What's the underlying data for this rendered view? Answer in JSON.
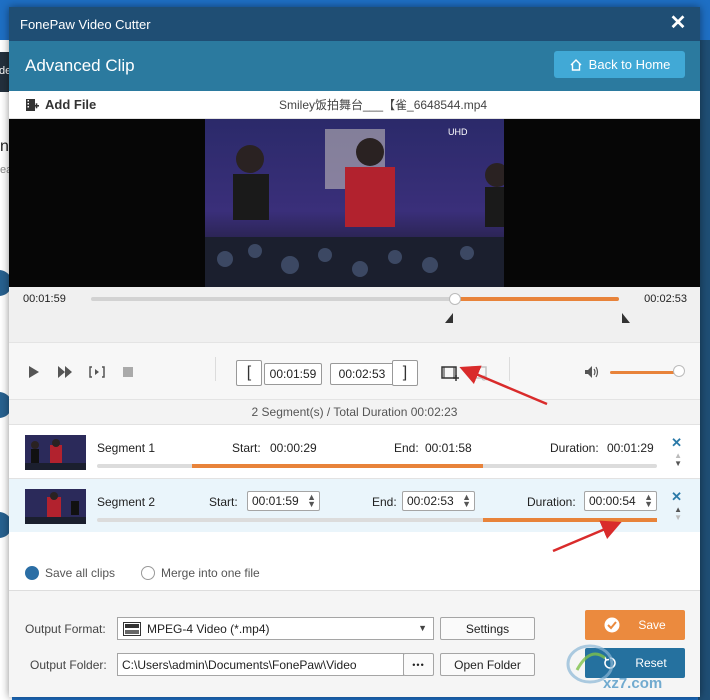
{
  "window": {
    "title": "FonePaw Video Cutter",
    "close_label": "✕"
  },
  "header": {
    "title": "Advanced Clip",
    "home_button": "Back to Home"
  },
  "filebar": {
    "add_label": "Add File",
    "file_name": "Smiley饭拍舞台___【雀_6648544.mp4"
  },
  "timeline": {
    "start_time": "00:01:59",
    "end_time": "00:02:53",
    "playhead_fraction": 0.69,
    "range_end_fraction": 1.0
  },
  "controls": {
    "clip_start": "00:01:59",
    "clip_end": "00:02:53",
    "volume_fraction": 1.0
  },
  "summary": "2 Segment(s) / Total Duration 00:02:23",
  "segments": [
    {
      "name": "Segment 1",
      "start_label": "Start:",
      "start": "00:00:29",
      "end_label": "End:",
      "end": "00:01:58",
      "duration_label": "Duration:",
      "duration": "00:01:29",
      "range": [
        0.17,
        0.69
      ]
    },
    {
      "name": "Segment 2",
      "start_label": "Start:",
      "start": "00:01:59",
      "end_label": "End:",
      "end": "00:02:53",
      "duration_label": "Duration:",
      "duration": "00:00:54",
      "range": [
        0.69,
        1.0
      ]
    }
  ],
  "options": {
    "save_all": "Save all clips",
    "merge": "Merge into one file"
  },
  "output": {
    "format_label": "Output Format:",
    "format_value": "MPEG-4 Video (*.mp4)",
    "settings_button": "Settings",
    "folder_label": "Output Folder:",
    "folder_path": "C:\\Users\\admin\\Documents\\FonePaw\\Video",
    "browse_button": "•••",
    "open_folder_button": "Open Folder",
    "save_button": "Save",
    "reset_button": "Reset"
  },
  "background": {
    "left_text_1": "de",
    "left_text_2": "n",
    "left_text_3": "ea"
  },
  "watermark_text": "xz7.com",
  "colors": {
    "titlebar": "#1f4e74",
    "header": "#2b7a9f",
    "accent": "#e8833a",
    "reset": "#25719f",
    "arrow": "#d92b2b"
  }
}
